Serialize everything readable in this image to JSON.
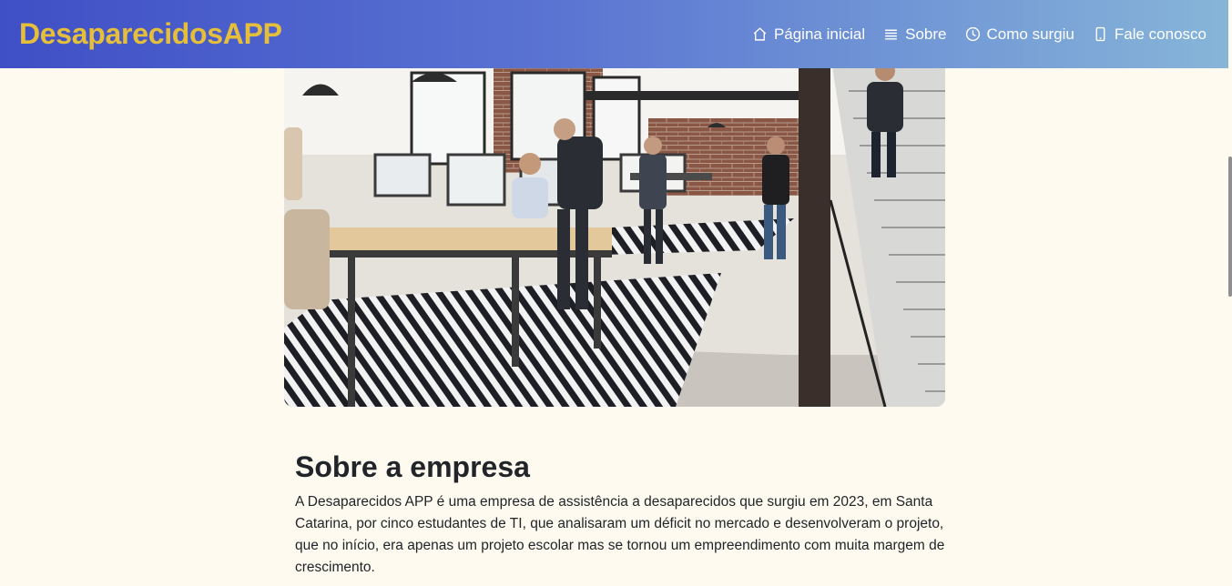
{
  "brand": "DesaparecidosAPP",
  "nav": [
    {
      "label": "Página inicial",
      "icon": "home-icon"
    },
    {
      "label": "Sobre",
      "icon": "list-icon"
    },
    {
      "label": "Como surgiu",
      "icon": "clock-icon"
    },
    {
      "label": "Fale conosco",
      "icon": "phone-icon"
    }
  ],
  "hero": {
    "image": "office-photo"
  },
  "about": {
    "title": "Sobre a empresa",
    "text": "A Desaparecidos APP é uma empresa de assistência a desaparecidos que surgiu em 2023, em Santa Catarina, por cinco estudantes de TI, que analisaram um déficit no mercado e desenvolveram o projeto, que no início, era apenas um projeto escolar mas se tornou um empreendimento com muita margem de crescimento."
  },
  "colors": {
    "brand": "#e6bf3a",
    "background": "#fefaef",
    "navbar_start": "#3f4fc6",
    "navbar_end": "#86b5d8"
  }
}
